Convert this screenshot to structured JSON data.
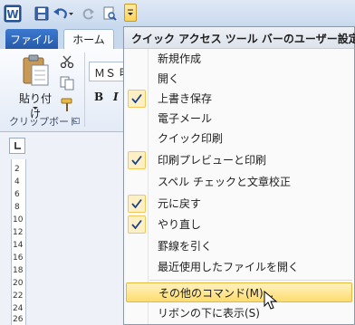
{
  "qat": {
    "app_icon_letter": "W",
    "icons": [
      "word-icon",
      "save-icon",
      "undo-icon",
      "redo-icon",
      "print-preview-icon",
      "customize-qat-icon"
    ]
  },
  "tabs": {
    "file": "ファイル",
    "home": "ホーム"
  },
  "ribbon": {
    "paste_label": "貼り付け",
    "font_name": "ＭＳ 明",
    "bold": "B",
    "italic": "I",
    "group_label": "クリップボード"
  },
  "ruler": [
    "2",
    "4",
    "6",
    "8",
    "10",
    "12",
    "14",
    "16",
    "18",
    "20",
    "22",
    "24",
    "26"
  ],
  "menu": {
    "title": "クイック アクセス ツール バーのユーザー設定",
    "items": [
      {
        "label": "新規作成",
        "checked": false
      },
      {
        "label": "開く",
        "checked": false
      },
      {
        "label": "上書き保存",
        "checked": true
      },
      {
        "label": "電子メール",
        "checked": false
      },
      {
        "label": "クイック印刷",
        "checked": false
      },
      {
        "label": "印刷プレビューと印刷",
        "checked": true
      },
      {
        "label": "スペル チェックと文章校正",
        "checked": false
      },
      {
        "label": "元に戻す",
        "checked": true
      },
      {
        "label": "やり直し",
        "checked": true
      },
      {
        "label": "罫線を引く",
        "checked": false
      },
      {
        "label": "最近使用したファイルを開く",
        "checked": false
      }
    ],
    "more_commands": "その他のコマンド(M)...",
    "show_below": "リボンの下に表示(S)"
  },
  "colors": {
    "file_tab": "#2a5fae",
    "highlight": "#fddc6f",
    "check_bg": "#fcf0c4"
  }
}
